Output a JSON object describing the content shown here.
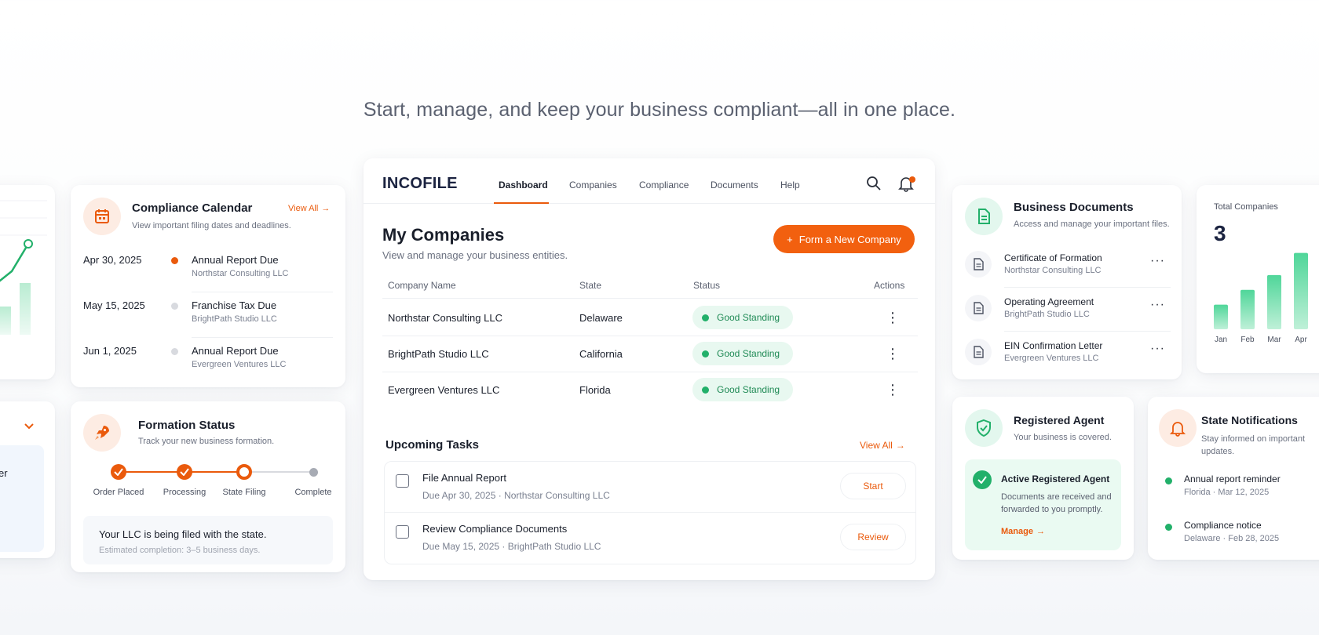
{
  "headline": "Start, manage, and keep your business compliant—all in one place.",
  "colors": {
    "accent": "#ea5a0c",
    "success": "#22b06a",
    "navy": "#1b2340"
  },
  "calendar": {
    "title": "Compliance Calendar",
    "subtitle": "View important filing dates and deadlines.",
    "view_all": "View All",
    "icon": "calendar-icon",
    "items": [
      {
        "date": "Apr 30, 2025",
        "event": "Annual Report Due",
        "company": "Northstar Consulting LLC",
        "status": "active"
      },
      {
        "date": "May 15, 2025",
        "event": "Franchise Tax Due",
        "company": "BrightPath Studio LLC",
        "status": "pending"
      },
      {
        "date": "Jun 1, 2025",
        "event": "Annual Report Due",
        "company": "Evergreen Ventures LLC",
        "status": "pending"
      }
    ]
  },
  "formation": {
    "title": "Formation Status",
    "subtitle": "Track your new business formation.",
    "icon": "rocket-icon",
    "steps": [
      "Order Placed",
      "Processing",
      "State Filing",
      "Complete"
    ],
    "current_step": 3,
    "message": "Your LLC is being filed with the state.",
    "eta": "Estimated completion: 3–5 business days."
  },
  "partial_left": {
    "text": "er"
  },
  "app": {
    "logo": "INCOFILE",
    "nav": [
      "Dashboard",
      "Companies",
      "Compliance",
      "Documents",
      "Help"
    ],
    "active_nav": "Dashboard",
    "page_title": "My Companies",
    "page_subtitle": "View and manage your business entities.",
    "primary_button": "Form a New Company",
    "table": {
      "headers": [
        "Company Name",
        "State",
        "Status",
        "Actions"
      ],
      "rows": [
        {
          "name": "Northstar Consulting LLC",
          "state": "Delaware",
          "status": "Good Standing"
        },
        {
          "name": "BrightPath Studio LLC",
          "state": "California",
          "status": "Good Standing"
        },
        {
          "name": "Evergreen Ventures LLC",
          "state": "Florida",
          "status": "Good Standing"
        }
      ]
    },
    "tasks": {
      "title": "Upcoming Tasks",
      "view_all": "View All",
      "items": [
        {
          "title": "File Annual Report",
          "detail": "Due Apr 30, 2025 · Northstar Consulting LLC",
          "action": "Start"
        },
        {
          "title": "Review Compliance Documents",
          "detail": "Due May 15, 2025 · BrightPath Studio LLC",
          "action": "Review"
        }
      ]
    }
  },
  "documents": {
    "title": "Business Documents",
    "subtitle": "Access and manage your important files.",
    "icon": "document-icon",
    "items": [
      {
        "name": "Certificate of Formation",
        "company": "Northstar Consulting LLC"
      },
      {
        "name": "Operating Agreement",
        "company": "BrightPath Studio LLC"
      },
      {
        "name": "EIN Confirmation Letter",
        "company": "Evergreen Ventures LLC"
      }
    ]
  },
  "total": {
    "label": "Total Companies",
    "value": "3",
    "chart_data": {
      "type": "bar",
      "categories": [
        "Jan",
        "Feb",
        "Mar",
        "Apr"
      ],
      "values": [
        1,
        1.6,
        2.2,
        3.1
      ],
      "ylim": [
        0,
        3.5
      ],
      "grid": false
    }
  },
  "agent": {
    "title": "Registered Agent",
    "subtitle": "Your business is covered.",
    "icon": "shield-check-icon",
    "status_title": "Active Registered Agent",
    "status_text": "Documents are received and forwarded to you promptly.",
    "manage": "Manage"
  },
  "notifications": {
    "title": "State Notifications",
    "subtitle": "Stay informed on important updates.",
    "icon": "bell-icon",
    "items": [
      {
        "title": "Annual report reminder",
        "meta": "Florida · Mar 12, 2025"
      },
      {
        "title": "Compliance notice",
        "meta": "Delaware · Feb 28, 2025"
      }
    ]
  }
}
